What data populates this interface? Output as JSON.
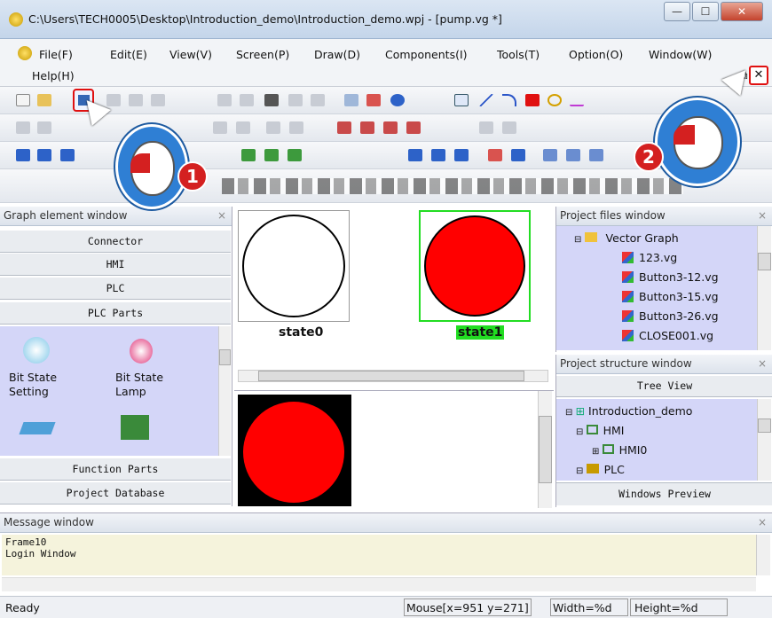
{
  "window": {
    "title": "C:\\Users\\TECH0005\\Desktop\\Introduction_demo\\Introduction_demo.wpj - [pump.vg *]",
    "min_glyph": "—",
    "max_glyph": "☐",
    "close_glyph": "✕"
  },
  "menu": {
    "items": [
      "File(F)",
      "Edit(E)",
      "View(V)",
      "Screen(P)",
      "Draw(D)",
      "Components(I)",
      "Tools(T)",
      "Option(O)",
      "Window(W)",
      "Help(H)"
    ],
    "mdi_min": "–",
    "mdi_restore": "⧉",
    "mdi_close": "✕"
  },
  "graph_element_window": {
    "title": "Graph element window",
    "categories": [
      "Connector",
      "HMI",
      "PLC",
      "PLC Parts"
    ],
    "items": [
      {
        "label": "Bit State Setting",
        "icon": "bit-state-setting-icon"
      },
      {
        "label": "Bit State Lamp",
        "icon": "bit-state-lamp-icon"
      }
    ],
    "bottom_categories": [
      "Function Parts",
      "Project Database"
    ]
  },
  "canvas": {
    "state_labels": [
      "state0",
      "state1"
    ],
    "colors": {
      "fill_red": "#ff0000",
      "select_green": "#22dd22",
      "black": "#000000"
    }
  },
  "project_files_window": {
    "title": "Project files window",
    "folder": "Vector Graph",
    "files": [
      "123.vg",
      "Button3-12.vg",
      "Button3-15.vg",
      "Button3-26.vg",
      "CLOSE001.vg"
    ]
  },
  "project_structure_window": {
    "title": "Project structure window",
    "tree_view_tab": "Tree View",
    "nodes": [
      "Introduction_demo",
      "HMI",
      "HMI0",
      "PLC"
    ],
    "windows_preview_tab": "Windows Preview"
  },
  "message_window": {
    "title": "Message window",
    "lines": [
      "Frame10",
      "Login Window"
    ]
  },
  "statusbar": {
    "ready": "Ready",
    "mouse": "Mouse[x=951  y=271]",
    "width": "Width=%d",
    "height": "Height=%d"
  },
  "callouts": {
    "step1": "1",
    "step2": "2"
  },
  "accent": {
    "callout_red": "#d42020",
    "mouse_blue": "#2f7fd4",
    "highlight_red": "#e01010"
  }
}
